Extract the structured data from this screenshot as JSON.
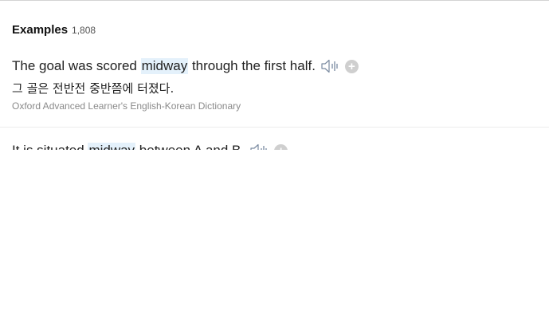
{
  "section": {
    "title": "Examples",
    "count": "1,808"
  },
  "examples": [
    {
      "before": "The goal was scored ",
      "highlight": "midway",
      "after": " through the first half.",
      "translation": "그 골은 전반전 중반쯤에 터졌다.",
      "source": "Oxford Advanced Learner's English-Korean Dictionary"
    },
    {
      "before": "It is situated ",
      "highlight": "midway",
      "after": " between A and B."
    }
  ],
  "icons": {
    "speaker": "speaker-icon",
    "add": "plus-circle-icon"
  },
  "colors": {
    "highlight": "#e4f1fb",
    "speaker": "#7a8aa0",
    "add_button": "#cfcfcf",
    "source_text": "#8a8a8a"
  }
}
